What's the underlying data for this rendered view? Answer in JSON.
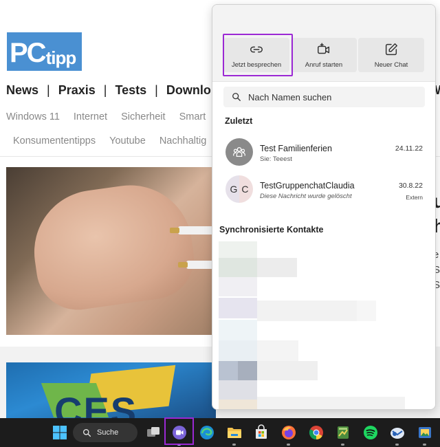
{
  "website": {
    "logo_pc": "PC",
    "logo_tipp": "tipp",
    "nav": [
      "News",
      "Praxis",
      "Tests",
      "Downlo"
    ],
    "nav_separator": "|",
    "subnav_row1": [
      "Windows 11",
      "Internet",
      "Sicherheit",
      "Smart"
    ],
    "subnav_row2": [
      "Konsumententipps",
      "Youtube",
      "Nachhaltig"
    ],
    "ces_text": "CES",
    "right_cut_lines": [
      "u",
      "h"
    ],
    "right_cut_small": [
      "e",
      "S",
      "S"
    ],
    "top_cut": "W"
  },
  "flyout": {
    "actions": [
      {
        "label": "Jetzt besprechen",
        "icon": "link-icon"
      },
      {
        "label": "Anruf starten",
        "icon": "video-add-icon"
      },
      {
        "label": "Neuer Chat",
        "icon": "compose-icon"
      }
    ],
    "search_placeholder": "Nach Namen suchen",
    "recent_title": "Zuletzt",
    "chats": [
      {
        "name": "Test Familienferien",
        "preview": "Sie: Teeest",
        "date": "24.11.22",
        "avatar": "group-icon"
      },
      {
        "name": "TestGruppenchatClaudia",
        "preview": "Diese Nachricht wurde gelöscht",
        "date": "30.8.22",
        "badge": "Extern",
        "initials": [
          "G",
          "C"
        ]
      }
    ],
    "sync_title": "Synchronisierte Kontakte"
  },
  "taskbar": {
    "search_label": "Suche",
    "apps": [
      "windows-start-icon",
      "task-view-icon",
      "teams-chat-icon",
      "edge-icon",
      "explorer-icon",
      "store-icon",
      "firefox-icon",
      "chrome-icon",
      "notepad-icon",
      "spotify-icon",
      "mail-icon",
      "photos-icon"
    ]
  },
  "colors": {
    "highlight": "#9b28d4",
    "taskbar": "#1c1c1c",
    "logo": "#4a90d2"
  }
}
